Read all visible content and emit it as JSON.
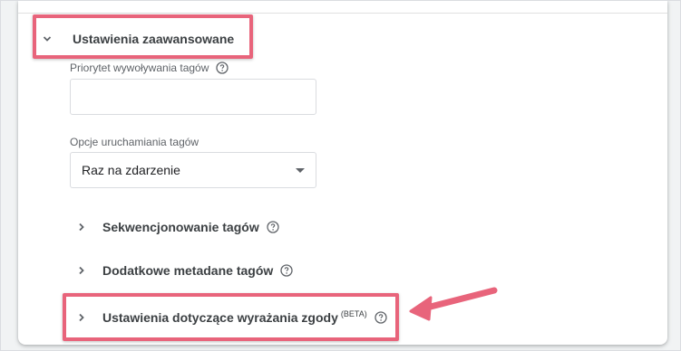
{
  "advanced_settings": {
    "title": "Ustawienia zaawansowane",
    "expanded": true,
    "icon": "chevron-down-icon"
  },
  "tag_firing_priority": {
    "label": "Priorytet wywoływania tagów",
    "value": "",
    "help_icon": "help-circle-icon"
  },
  "tag_firing_options": {
    "label": "Opcje uruchamiania tagów",
    "selected": "Raz na zdarzenie"
  },
  "collapsible_sections": [
    {
      "title": "Sekwencjonowanie tagów",
      "icon": "chevron-right-icon",
      "help_icon": "help-circle-icon"
    },
    {
      "title": "Dodatkowe metadane tagów",
      "icon": "chevron-right-icon",
      "help_icon": "help-circle-icon"
    },
    {
      "title": "Ustawienia dotyczące wyrażania zgody",
      "badge": "(BETA)",
      "icon": "chevron-right-icon",
      "help_icon": "help-circle-icon"
    }
  ],
  "colors": {
    "highlight": "#e8647b",
    "text": "#3c4043",
    "border": "#dadce0"
  }
}
